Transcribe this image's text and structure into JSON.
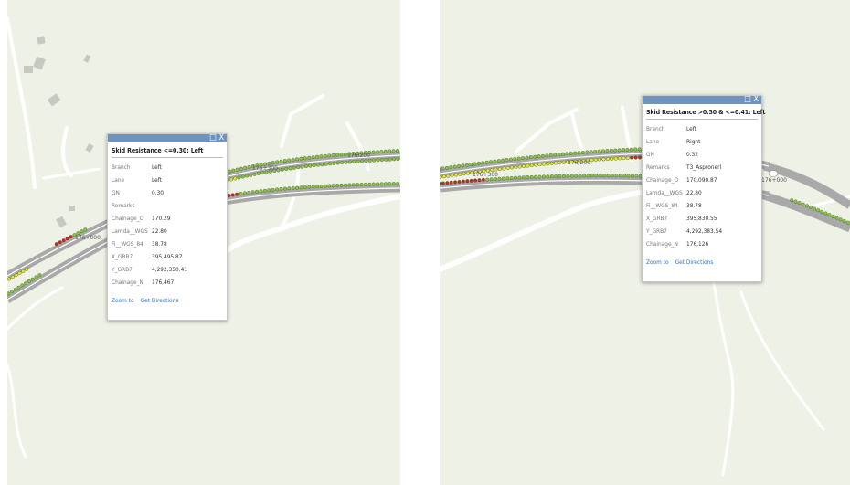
{
  "map_left": {
    "station_labels": [
      "176/200",
      "176+300",
      "176+000"
    ],
    "popup": {
      "title": "Skid Resistance <=0.30: Left",
      "controls": "□ X",
      "fields": [
        {
          "key": "Branch",
          "value": "Left"
        },
        {
          "key": "Lane",
          "value": "Left"
        },
        {
          "key": "GN",
          "value": "0.30"
        },
        {
          "key": "Remarks",
          "value": ""
        },
        {
          "key": "Chainage_O",
          "value": "170.29"
        },
        {
          "key": "Lamda__WGS",
          "value": "22.80"
        },
        {
          "key": "Fi__WGS_84",
          "value": "38.78"
        },
        {
          "key": "X_GRB7",
          "value": "395,495.87"
        },
        {
          "key": "Y_GRB7",
          "value": "4,292,350.41"
        },
        {
          "key": "Chainage_N",
          "value": "176,467"
        }
      ],
      "zoom_to": "Zoom to",
      "get_directions": "Get Directions"
    }
  },
  "map_right": {
    "station_labels": [
      "176/200",
      "176+300",
      "176+000"
    ],
    "popup": {
      "title": "Skid Resistance >0.30 & <=0.41: Left",
      "controls": "□ X",
      "fields": [
        {
          "key": "Branch",
          "value": "Left"
        },
        {
          "key": "Lane",
          "value": "Right"
        },
        {
          "key": "GN",
          "value": "0.32"
        },
        {
          "key": "Remarks",
          "value": "T3_Aspronerl"
        },
        {
          "key": "Chainage_O",
          "value": "170,090.87"
        },
        {
          "key": "Lamda__WGS",
          "value": "22.80"
        },
        {
          "key": "Fi__WGS_84",
          "value": "38.78"
        },
        {
          "key": "X_GRB7",
          "value": "395,830.55"
        },
        {
          "key": "Y_GRB7",
          "value": "4,292,383.54"
        },
        {
          "key": "Chainage_N",
          "value": "176,126"
        }
      ],
      "zoom_to": "Zoom to",
      "get_directions": "Get Directions"
    }
  },
  "colors": {
    "map_background": "#eef1e5",
    "road": "#a9a9a9",
    "minor_road": "#ffffff",
    "point_green": "#8bc34a",
    "point_yellow": "#e8e83a",
    "point_red": "#c62828",
    "popup_bar": "#6e93bf",
    "link": "#2f6fb3"
  }
}
